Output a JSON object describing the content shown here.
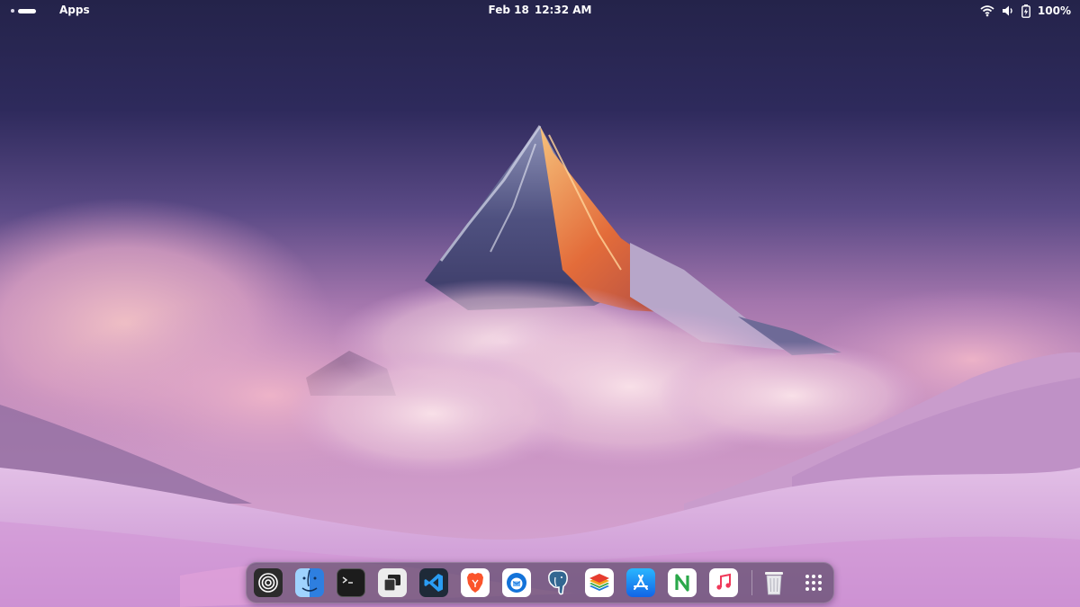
{
  "topbar": {
    "apps_label": "Apps",
    "date": "Feb 18",
    "time": "12:32 AM",
    "battery": "100%",
    "icons": [
      "activities-indicator",
      "wifi-icon",
      "volume-icon",
      "battery-icon"
    ]
  },
  "dock": {
    "apps": [
      {
        "name": "launchpad-icon",
        "bg": "#2b2b2b"
      },
      {
        "name": "finder-icon",
        "bg": "#3a8ee6"
      },
      {
        "name": "terminal-icon",
        "bg": "#1c1c1c"
      },
      {
        "name": "window-manager-icon",
        "bg": "#ececec"
      },
      {
        "name": "vscode-icon",
        "bg": "#1e2a38"
      },
      {
        "name": "brave-icon",
        "bg": "#ffffff"
      },
      {
        "name": "thunderbird-icon",
        "bg": "#ffffff"
      },
      {
        "name": "postgresql-icon",
        "bg": "transparent"
      },
      {
        "name": "layers-icon",
        "bg": "#ffffff"
      },
      {
        "name": "app-store-icon",
        "bg": "#1f8ef1"
      },
      {
        "name": "n-app-icon",
        "bg": "#ffffff"
      },
      {
        "name": "music-icon",
        "bg": "#ffffff"
      },
      {
        "name": "trash-icon",
        "bg": "transparent"
      },
      {
        "name": "show-apps-grid-icon",
        "bg": "transparent"
      }
    ]
  },
  "colors": {
    "sky_top": "#2a2550",
    "sky_mid": "#6b4f8f",
    "haze": "#b882b4",
    "peak_lit": "#e8743c",
    "meadow": "#d8a6d8"
  }
}
